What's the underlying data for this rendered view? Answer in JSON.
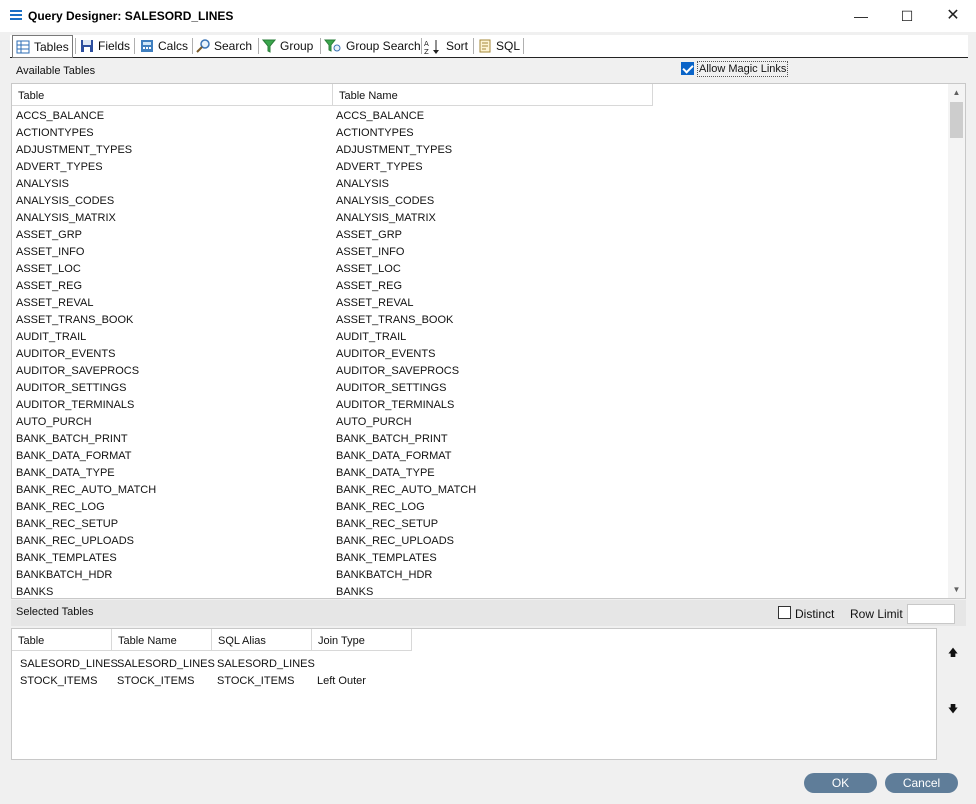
{
  "window": {
    "title": "Query Designer: SALESORD_LINES",
    "controls": [
      "minimize",
      "maximize",
      "close"
    ]
  },
  "toolbar": {
    "tabs": [
      {
        "label": "Tables",
        "icon": "table-icon",
        "active": true
      },
      {
        "label": "Fields",
        "icon": "save-disk-icon"
      },
      {
        "label": "Calcs",
        "icon": "calculator-icon"
      },
      {
        "label": "Search",
        "icon": "magnifier-icon"
      },
      {
        "label": "Group",
        "icon": "funnel-icon"
      },
      {
        "label": "Group Search",
        "icon": "funnel-search-icon"
      },
      {
        "label": "Sort",
        "icon": "sort-az-icon"
      },
      {
        "label": "SQL",
        "icon": "sql-script-icon"
      }
    ]
  },
  "available": {
    "section_label": "Available Tables",
    "magic_links_label": "Allow Magic Links",
    "magic_links_checked": true,
    "columns": [
      "Table",
      "Table Name"
    ],
    "rows": [
      [
        "ACCS_BALANCE",
        "ACCS_BALANCE"
      ],
      [
        "ACTIONTYPES",
        "ACTIONTYPES"
      ],
      [
        "ADJUSTMENT_TYPES",
        "ADJUSTMENT_TYPES"
      ],
      [
        "ADVERT_TYPES",
        "ADVERT_TYPES"
      ],
      [
        "ANALYSIS",
        "ANALYSIS"
      ],
      [
        "ANALYSIS_CODES",
        "ANALYSIS_CODES"
      ],
      [
        "ANALYSIS_MATRIX",
        "ANALYSIS_MATRIX"
      ],
      [
        "ASSET_GRP",
        "ASSET_GRP"
      ],
      [
        "ASSET_INFO",
        "ASSET_INFO"
      ],
      [
        "ASSET_LOC",
        "ASSET_LOC"
      ],
      [
        "ASSET_REG",
        "ASSET_REG"
      ],
      [
        "ASSET_REVAL",
        "ASSET_REVAL"
      ],
      [
        "ASSET_TRANS_BOOK",
        "ASSET_TRANS_BOOK"
      ],
      [
        "AUDIT_TRAIL",
        "AUDIT_TRAIL"
      ],
      [
        "AUDITOR_EVENTS",
        "AUDITOR_EVENTS"
      ],
      [
        "AUDITOR_SAVEPROCS",
        "AUDITOR_SAVEPROCS"
      ],
      [
        "AUDITOR_SETTINGS",
        "AUDITOR_SETTINGS"
      ],
      [
        "AUDITOR_TERMINALS",
        "AUDITOR_TERMINALS"
      ],
      [
        "AUTO_PURCH",
        "AUTO_PURCH"
      ],
      [
        "BANK_BATCH_PRINT",
        "BANK_BATCH_PRINT"
      ],
      [
        "BANK_DATA_FORMAT",
        "BANK_DATA_FORMAT"
      ],
      [
        "BANK_DATA_TYPE",
        "BANK_DATA_TYPE"
      ],
      [
        "BANK_REC_AUTO_MATCH",
        "BANK_REC_AUTO_MATCH"
      ],
      [
        "BANK_REC_LOG",
        "BANK_REC_LOG"
      ],
      [
        "BANK_REC_SETUP",
        "BANK_REC_SETUP"
      ],
      [
        "BANK_REC_UPLOADS",
        "BANK_REC_UPLOADS"
      ],
      [
        "BANK_TEMPLATES",
        "BANK_TEMPLATES"
      ],
      [
        "BANKBATCH_HDR",
        "BANKBATCH_HDR"
      ],
      [
        "BANKS",
        "BANKS"
      ]
    ]
  },
  "selected": {
    "section_label": "Selected Tables",
    "distinct_label": "Distinct",
    "distinct_checked": false,
    "row_limit_label": "Row Limit",
    "row_limit_value": "",
    "columns": [
      "Table",
      "Table Name",
      "SQL Alias",
      "Join Type"
    ],
    "rows": [
      [
        "SALESORD_LINES",
        "SALESORD_LINES",
        "SALESORD_LINES",
        ""
      ],
      [
        "STOCK_ITEMS",
        "STOCK_ITEMS",
        "STOCK_ITEMS",
        "Left Outer"
      ]
    ]
  },
  "footer": {
    "ok_label": "OK",
    "cancel_label": "Cancel"
  },
  "colors": {
    "button": "#5f7d99",
    "checkbox_checked": "#0a64c8"
  }
}
